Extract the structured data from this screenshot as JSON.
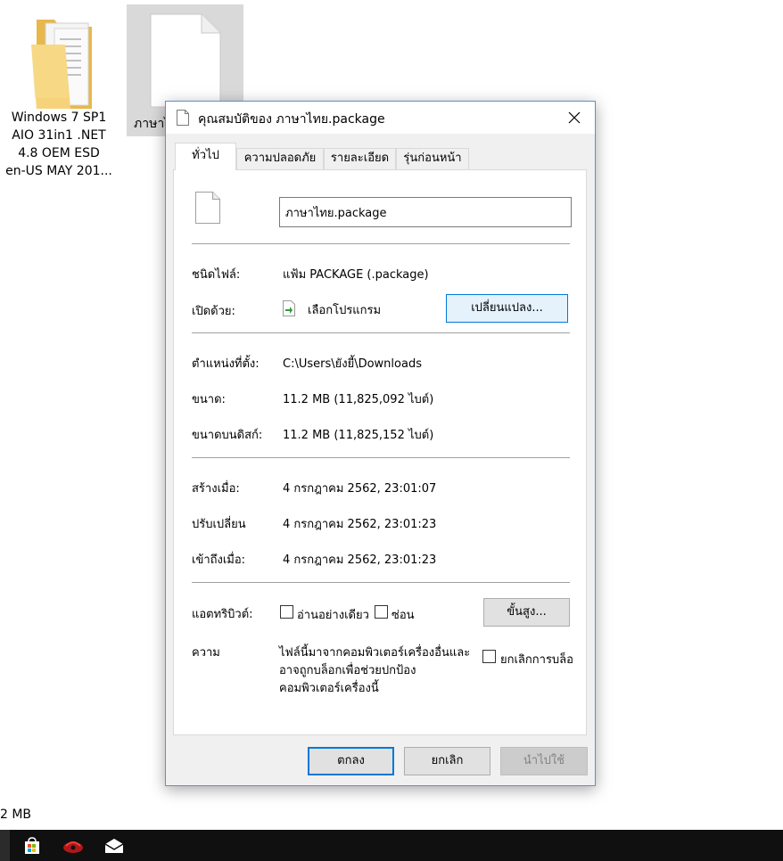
{
  "desktop": {
    "folder_label_lines": [
      "Windows 7 SP1",
      "AIO 31in1 .NET",
      "4.8 OEM ESD",
      "en-US MAY 201..."
    ],
    "file_label": "ภาษาไ",
    "status_size": "2 MB"
  },
  "dialog": {
    "title": "คุณสมบัติของ ภาษาไทย.package",
    "tabs": [
      {
        "label": "ทั่วไป",
        "active": true
      },
      {
        "label": "ความปลอดภัย",
        "active": false
      },
      {
        "label": "รายละเอียด",
        "active": false
      },
      {
        "label": "รุ่นก่อนหน้า",
        "active": false
      }
    ],
    "file_name": "ภาษาไทย.package",
    "fields": {
      "type_label": "ชนิดไฟล์:",
      "type_value": "แฟ้ม PACKAGE (.package)",
      "open_with_label": "เปิดด้วย:",
      "open_with_value": "เลือกโปรแกรม",
      "change_button": "เปลี่ยนแปลง...",
      "location_label": "ตำแหน่งที่ตั้ง:",
      "location_value": "C:\\Users\\ยังยี้\\Downloads",
      "size_label": "ขนาด:",
      "size_value": "11.2 MB (11,825,092 ไบต์)",
      "disk_size_label": "ขนาดบนดิสก์:",
      "disk_size_value": "11.2 MB (11,825,152 ไบต์)",
      "created_label": "สร้างเมื่อ:",
      "created_value": "4 กรกฎาคม 2562, 23:01:07",
      "modified_label": "ปรับเปลี่ยน",
      "modified_value": "4 กรกฎาคม 2562, 23:01:23",
      "accessed_label": "เข้าถึงเมื่อ:",
      "accessed_value": "4 กรกฎาคม 2562, 23:01:23",
      "attributes_label": "แอตทริบิวต์:",
      "readonly_label": "อ่านอย่างเดียว",
      "hidden_label": "ซ่อน",
      "advanced_button": "ขั้นสูง...",
      "security_label": "ความ",
      "security_text_lines": [
        "ไฟล์นี้มาจากคอมพิวเตอร์เครื่องอื่นและ",
        "อาจถูกบล็อกเพื่อช่วยปกป้อง",
        "คอมพิวเตอร์เครื่องนี้"
      ],
      "unblock_label": "ยกเลิกการบล็อ"
    },
    "buttons": {
      "ok": "ตกลง",
      "cancel": "ยกเลิก",
      "apply": "นำไปใช้"
    }
  },
  "colors": {
    "accent": "#0078d7",
    "taskbar": "#101010"
  }
}
